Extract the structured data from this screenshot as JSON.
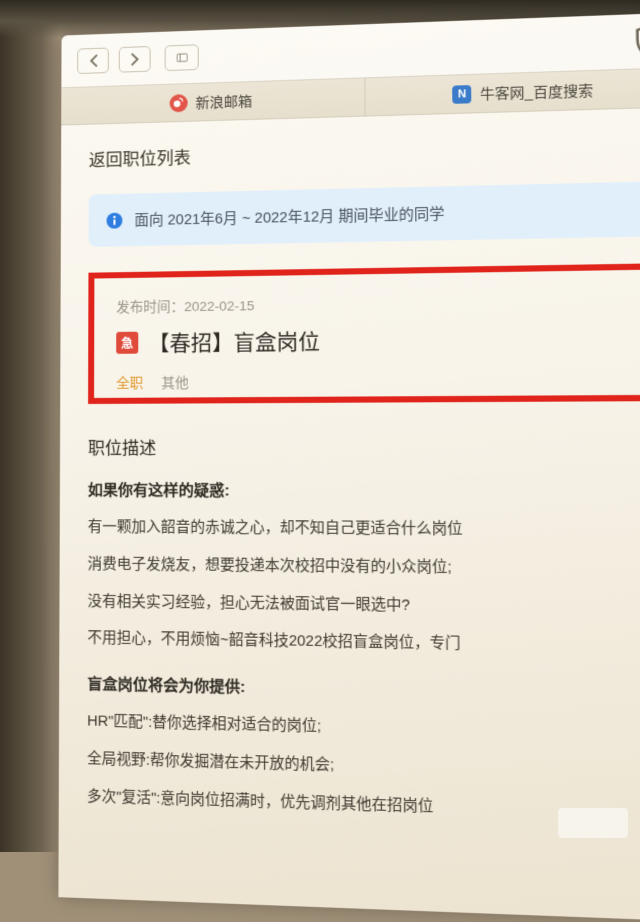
{
  "toolbar": {},
  "tabs": [
    {
      "label": "新浪邮箱"
    },
    {
      "label": "牛客网_百度搜索"
    }
  ],
  "backLink": "返回职位列表",
  "banner": "面向 2021年6月 ~ 2022年12月 期间毕业的同学",
  "posting": {
    "pubTimeLabel": "发布时间：",
    "pubTime": "2022-02-15",
    "urgentGlyph": "急",
    "title": "【春招】盲盒岗位",
    "type": "全职",
    "other": "其他"
  },
  "section": "职位描述",
  "sub1": "如果你有这样的疑惑:",
  "p1": "有一颗加入韶音的赤诚之心，却不知自己更适合什么岗位",
  "p2": "消费电子发烧友，想要投递本次校招中没有的小众岗位;",
  "p3": "没有相关实习经验，担心无法被面试官一眼选中?",
  "p4": "不用担心，不用烦恼~韶音科技2022校招盲盒岗位，专门",
  "sub2": "盲盒岗位将会为你提供:",
  "p5": "HR\"匹配\":替你选择相对适合的岗位;",
  "p6": "全局视野:帮你发掘潜在未开放的机会;",
  "p7": "多次\"复活\":意向岗位招满时，优先调剂其他在招岗位"
}
